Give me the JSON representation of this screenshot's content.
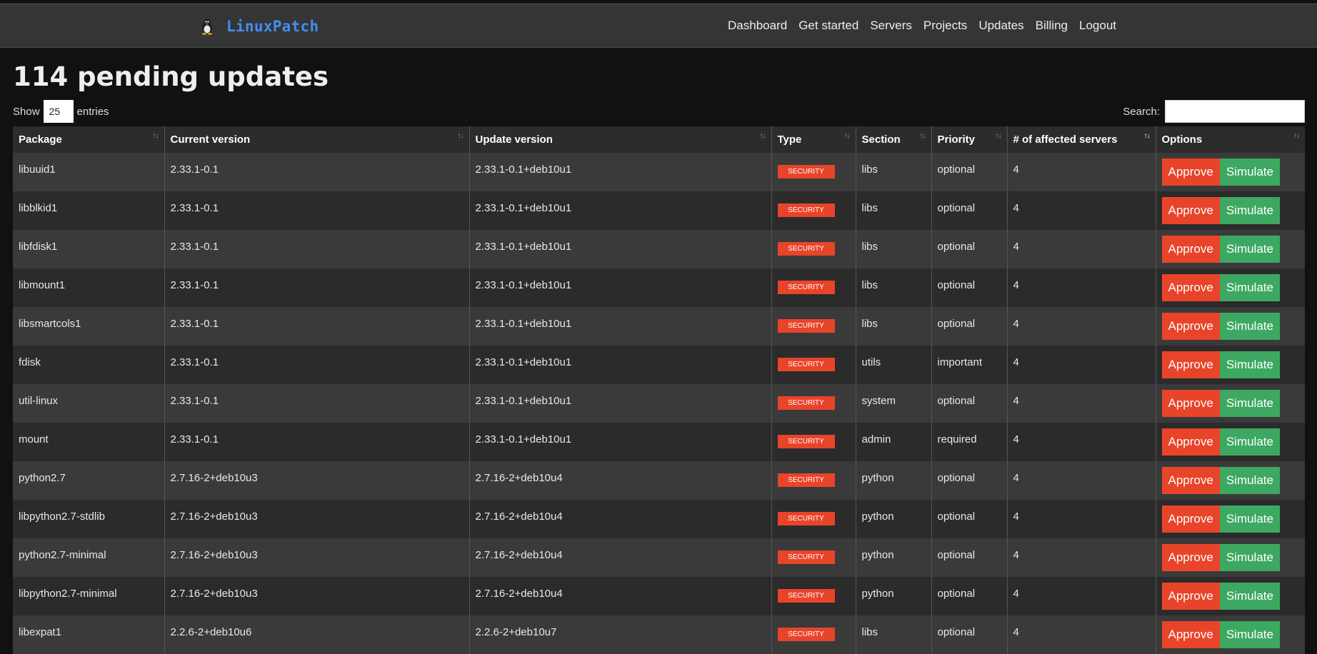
{
  "brand": {
    "name": "LinuxPatch",
    "icon": "tux-penguin-icon"
  },
  "nav": [
    "Dashboard",
    "Get started",
    "Servers",
    "Projects",
    "Updates",
    "Billing",
    "Logout"
  ],
  "page": {
    "title": "114 pending updates"
  },
  "length": {
    "show_label": "Show",
    "value": "25",
    "entries_label": "entries"
  },
  "search": {
    "label": "Search:",
    "value": ""
  },
  "table": {
    "columns": [
      "Package",
      "Current version",
      "Update version",
      "Type",
      "Section",
      "Priority",
      "# of affected servers",
      "Options"
    ],
    "sorted_column": "# of affected servers",
    "approve_label": "Approve",
    "simulate_label": "Simulate",
    "rows": [
      {
        "package": "libuuid1",
        "current": "2.33.1-0.1",
        "update": "2.33.1-0.1+deb10u1",
        "type": "SECURITY",
        "section": "libs",
        "priority": "optional",
        "affected": "4"
      },
      {
        "package": "libblkid1",
        "current": "2.33.1-0.1",
        "update": "2.33.1-0.1+deb10u1",
        "type": "SECURITY",
        "section": "libs",
        "priority": "optional",
        "affected": "4"
      },
      {
        "package": "libfdisk1",
        "current": "2.33.1-0.1",
        "update": "2.33.1-0.1+deb10u1",
        "type": "SECURITY",
        "section": "libs",
        "priority": "optional",
        "affected": "4"
      },
      {
        "package": "libmount1",
        "current": "2.33.1-0.1",
        "update": "2.33.1-0.1+deb10u1",
        "type": "SECURITY",
        "section": "libs",
        "priority": "optional",
        "affected": "4"
      },
      {
        "package": "libsmartcols1",
        "current": "2.33.1-0.1",
        "update": "2.33.1-0.1+deb10u1",
        "type": "SECURITY",
        "section": "libs",
        "priority": "optional",
        "affected": "4"
      },
      {
        "package": "fdisk",
        "current": "2.33.1-0.1",
        "update": "2.33.1-0.1+deb10u1",
        "type": "SECURITY",
        "section": "utils",
        "priority": "important",
        "affected": "4"
      },
      {
        "package": "util-linux",
        "current": "2.33.1-0.1",
        "update": "2.33.1-0.1+deb10u1",
        "type": "SECURITY",
        "section": "system",
        "priority": "optional",
        "affected": "4"
      },
      {
        "package": "mount",
        "current": "2.33.1-0.1",
        "update": "2.33.1-0.1+deb10u1",
        "type": "SECURITY",
        "section": "admin",
        "priority": "required",
        "affected": "4"
      },
      {
        "package": "python2.7",
        "current": "2.7.16-2+deb10u3",
        "update": "2.7.16-2+deb10u4",
        "type": "SECURITY",
        "section": "python",
        "priority": "optional",
        "affected": "4"
      },
      {
        "package": "libpython2.7-stdlib",
        "current": "2.7.16-2+deb10u3",
        "update": "2.7.16-2+deb10u4",
        "type": "SECURITY",
        "section": "python",
        "priority": "optional",
        "affected": "4"
      },
      {
        "package": "python2.7-minimal",
        "current": "2.7.16-2+deb10u3",
        "update": "2.7.16-2+deb10u4",
        "type": "SECURITY",
        "section": "python",
        "priority": "optional",
        "affected": "4"
      },
      {
        "package": "libpython2.7-minimal",
        "current": "2.7.16-2+deb10u3",
        "update": "2.7.16-2+deb10u4",
        "type": "SECURITY",
        "section": "python",
        "priority": "optional",
        "affected": "4"
      },
      {
        "package": "libexpat1",
        "current": "2.2.6-2+deb10u6",
        "update": "2.2.6-2+deb10u7",
        "type": "SECURITY",
        "section": "libs",
        "priority": "optional",
        "affected": "4"
      }
    ]
  },
  "colors": {
    "accent_red": "#e8442a",
    "accent_green": "#3da861",
    "brand_blue": "#3f8ff2"
  }
}
